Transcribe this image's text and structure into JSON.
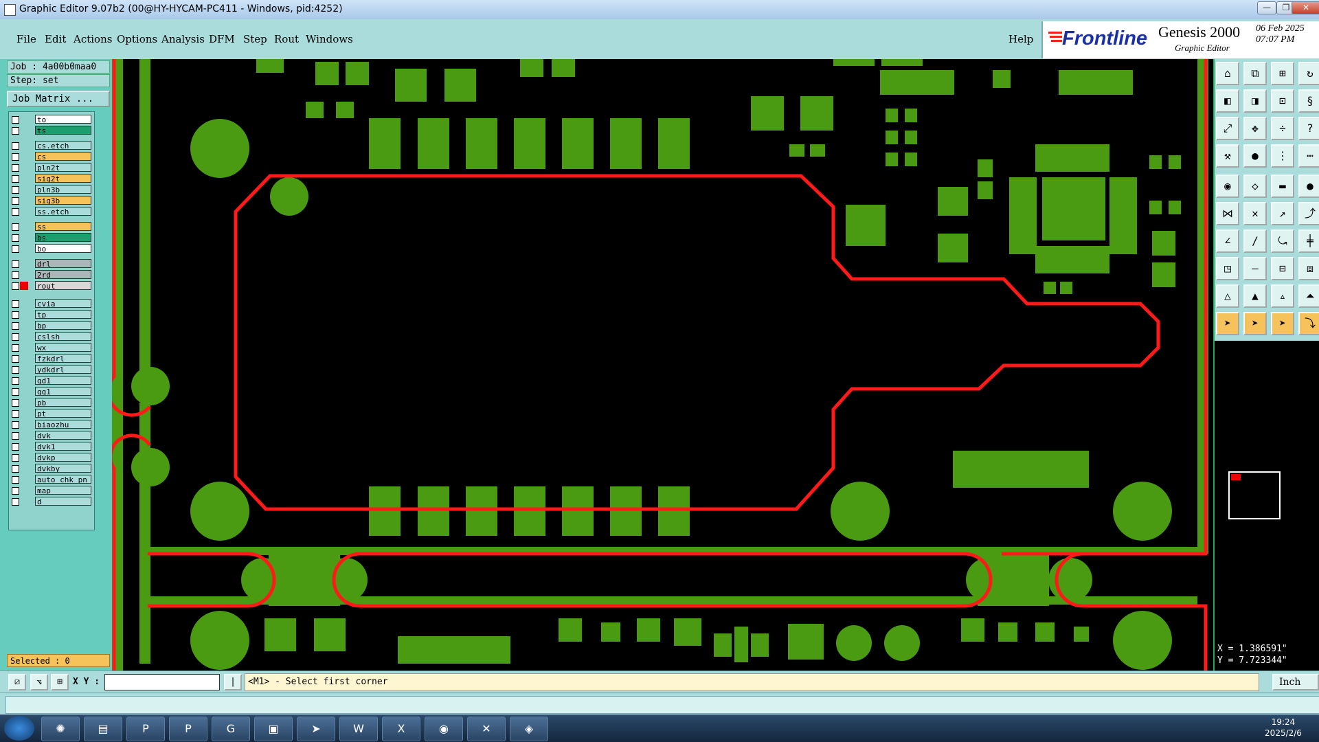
{
  "window": {
    "title": "Graphic Editor 9.07b2 (00@HY-HYCAM-PC411 - Windows, pid:4252)",
    "min_label": "—",
    "max_label": "❐",
    "close_label": "✕"
  },
  "menu": {
    "items": [
      "File",
      "Edit",
      "Actions",
      "Options",
      "Analysis",
      "DFM",
      "Step",
      "Rout",
      "Windows"
    ],
    "help": "Help"
  },
  "branding": {
    "logo_text": "Frontline",
    "product": "Genesis 2000",
    "module": "Graphic Editor",
    "date": "06 Feb 2025",
    "time": "07:07 PM"
  },
  "job": {
    "job_label": "Job : 4a00b0maa0",
    "step_label": "Step: set",
    "job_matrix_button": "Job Matrix ..."
  },
  "layers": [
    {
      "name": "to",
      "color": "#ffffff"
    },
    {
      "name": "ts",
      "color": "#1e9e6e"
    },
    {
      "name": "cs.etch",
      "color": "#a9dcdb"
    },
    {
      "name": "cs",
      "color": "#f6c25a"
    },
    {
      "name": "pln2t",
      "color": "#a9dcdb"
    },
    {
      "name": "sig2t",
      "color": "#f6c25a"
    },
    {
      "name": "pln3b",
      "color": "#a9dcdb"
    },
    {
      "name": "sig3b",
      "color": "#f6c25a"
    },
    {
      "name": "ss.etch",
      "color": "#a9dcdb"
    },
    {
      "name": "ss",
      "color": "#f6c25a"
    },
    {
      "name": "bs",
      "color": "#1e9e6e"
    },
    {
      "name": "bo",
      "color": "#ffffff"
    },
    {
      "name": "drl",
      "color": "#a8b8b8"
    },
    {
      "name": "2rd",
      "color": "#a8b8b8"
    },
    {
      "name": "rout",
      "color": "#d8d8d8"
    },
    {
      "name": "cvia",
      "color": "#a9dcdb"
    },
    {
      "name": "tp",
      "color": "#a9dcdb"
    },
    {
      "name": "bp",
      "color": "#a9dcdb"
    },
    {
      "name": "cslsh",
      "color": "#a9dcdb"
    },
    {
      "name": "wx",
      "color": "#a9dcdb"
    },
    {
      "name": "fzkdrl",
      "color": "#a9dcdb"
    },
    {
      "name": "ydkdrl",
      "color": "#a9dcdb"
    },
    {
      "name": "gd1",
      "color": "#a9dcdb"
    },
    {
      "name": "gg1",
      "color": "#a9dcdb"
    },
    {
      "name": "pb",
      "color": "#a9dcdb"
    },
    {
      "name": "pt",
      "color": "#a9dcdb"
    },
    {
      "name": "biaozhu",
      "color": "#a9dcdb"
    },
    {
      "name": "dvk",
      "color": "#a9dcdb"
    },
    {
      "name": "dvk1",
      "color": "#a9dcdb"
    },
    {
      "name": "dvkp",
      "color": "#a9dcdb"
    },
    {
      "name": "dvkby",
      "color": "#a9dcdb"
    },
    {
      "name": "auto_chk_pn",
      "color": "#a9dcdb"
    },
    {
      "name": "map",
      "color": "#a9dcdb"
    },
    {
      "name": "d",
      "color": "#a9dcdb"
    }
  ],
  "selected_label": "Selected : 0",
  "command": {
    "xy_label": "X Y :",
    "xy_value": "",
    "prompt": "<M1> - Select first corner",
    "unit": "Inch"
  },
  "coords": {
    "x": "X = 1.386591\"",
    "y": "Y = 7.723344\""
  },
  "colors": {
    "pad": "#4a9a12",
    "outline": "#ff1a1a",
    "panel": "#a9dcdb"
  },
  "clock": {
    "time": "19:24",
    "date": "2025/2/6"
  }
}
